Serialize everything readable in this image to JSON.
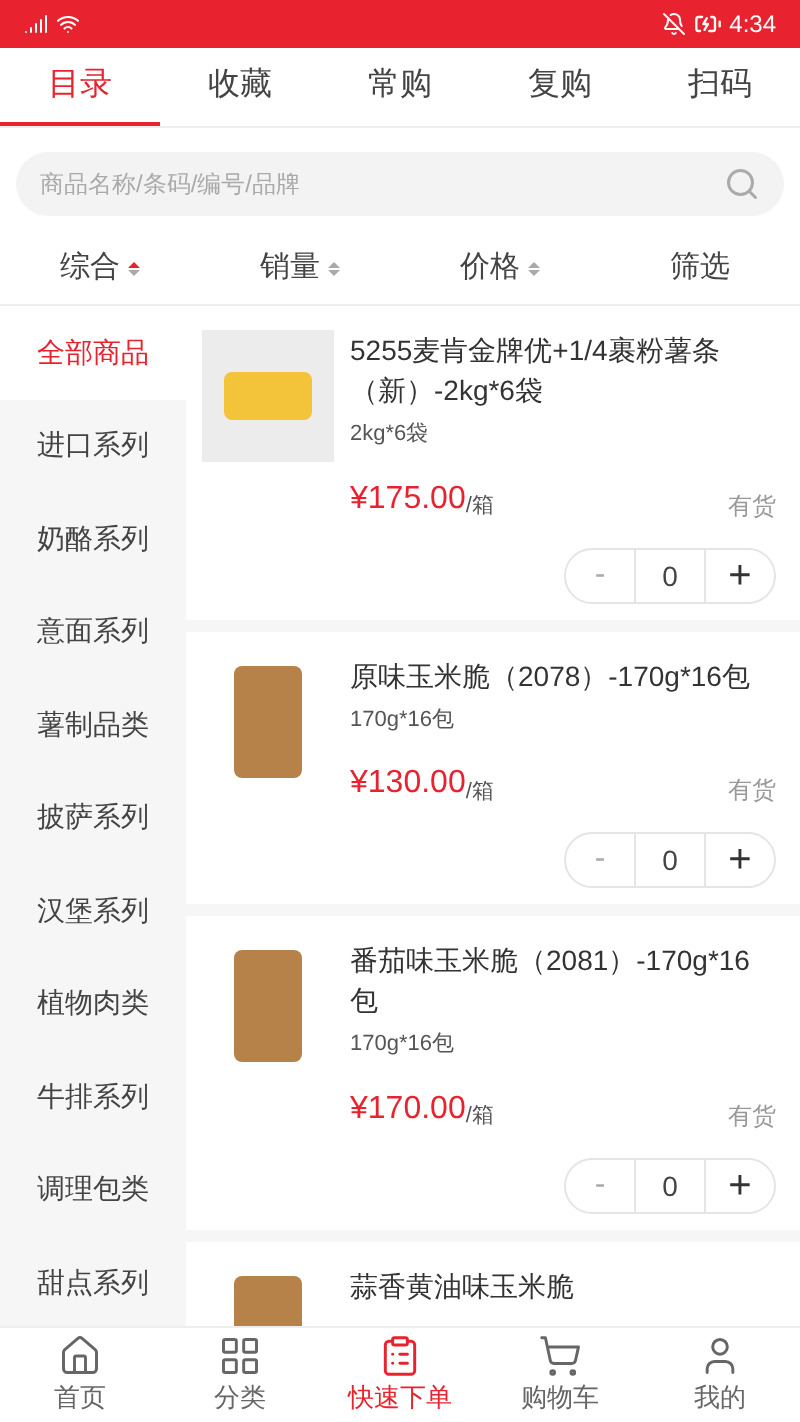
{
  "status_bar": {
    "time": "4:34"
  },
  "tabs": [
    {
      "label": "目录",
      "selected": true
    },
    {
      "label": "收藏",
      "selected": false
    },
    {
      "label": "常购",
      "selected": false
    },
    {
      "label": "复购",
      "selected": false
    },
    {
      "label": "扫码",
      "selected": false
    }
  ],
  "search": {
    "placeholder": "商品名称/条码/编号/品牌"
  },
  "sort_options": [
    {
      "label": "综合",
      "kind": "sort",
      "selected": true
    },
    {
      "label": "销量",
      "kind": "sort",
      "selected": false
    },
    {
      "label": "价格",
      "kind": "sort",
      "selected": false
    },
    {
      "label": "筛选",
      "kind": "filter",
      "selected": false
    }
  ],
  "categories": [
    {
      "label": "全部商品",
      "selected": true
    },
    {
      "label": "进口系列",
      "selected": false
    },
    {
      "label": "奶酪系列",
      "selected": false
    },
    {
      "label": "意面系列",
      "selected": false
    },
    {
      "label": "薯制品类",
      "selected": false
    },
    {
      "label": "披萨系列",
      "selected": false
    },
    {
      "label": "汉堡系列",
      "selected": false
    },
    {
      "label": "植物肉类",
      "selected": false
    },
    {
      "label": "牛排系列",
      "selected": false
    },
    {
      "label": "调理包类",
      "selected": false
    },
    {
      "label": "甜点系列",
      "selected": false
    }
  ],
  "products": [
    {
      "name": "5255麦肯金牌优+1/4裹粉薯条（新）-2kg*6袋",
      "spec": "2kg*6袋",
      "price": "¥175.00",
      "unit": "/箱",
      "stock": "有货",
      "quantity": "0",
      "minus": "-",
      "plus": "+"
    },
    {
      "name": "原味玉米脆（2078）-170g*16包",
      "spec": "170g*16包",
      "price": "¥130.00",
      "unit": "/箱",
      "stock": "有货",
      "quantity": "0",
      "minus": "-",
      "plus": "+"
    },
    {
      "name": "番茄味玉米脆（2081）-170g*16包",
      "spec": "170g*16包",
      "price": "¥170.00",
      "unit": "/箱",
      "stock": "有货",
      "quantity": "0",
      "minus": "-",
      "plus": "+"
    },
    {
      "name": "蒜香黄油味玉米脆"
    }
  ],
  "bottom_nav": [
    {
      "label": "首页",
      "selected": false
    },
    {
      "label": "分类",
      "selected": false
    },
    {
      "label": "快速下单",
      "selected": true
    },
    {
      "label": "购物车",
      "selected": false
    },
    {
      "label": "我的",
      "selected": false
    }
  ]
}
